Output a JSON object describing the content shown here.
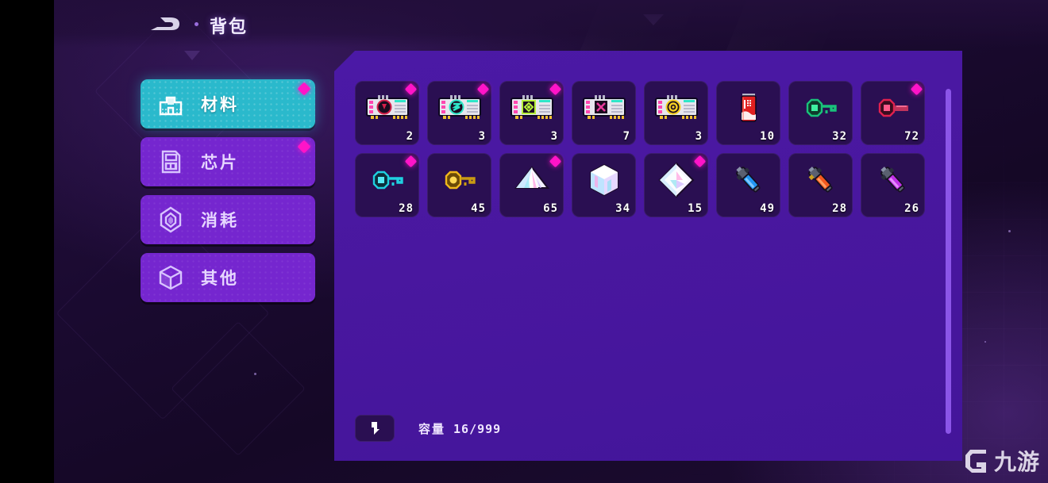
{
  "header": {
    "title": "背包",
    "logo_icon": "game-logo-icon"
  },
  "sidebar": {
    "items": [
      {
        "label": "材料",
        "icon": "materials-icon",
        "active": true,
        "badge": true
      },
      {
        "label": "芯片",
        "icon": "chip-icon",
        "active": false,
        "badge": true
      },
      {
        "label": "消耗",
        "icon": "gem-icon",
        "active": false,
        "badge": false
      },
      {
        "label": "其他",
        "icon": "cube-icon",
        "active": false,
        "badge": false
      }
    ]
  },
  "inventory": {
    "rows": [
      [
        {
          "icon": "gpu-card-red-icon",
          "count": "2",
          "badge": true
        },
        {
          "icon": "gpu-card-cyan-icon",
          "count": "3",
          "badge": true
        },
        {
          "icon": "gpu-card-green-icon",
          "count": "3",
          "badge": true
        },
        {
          "icon": "gpu-card-magenta-icon",
          "count": "7",
          "badge": false
        },
        {
          "icon": "gpu-card-yellow-icon",
          "count": "3",
          "badge": false
        },
        {
          "icon": "soda-can-icon",
          "count": "10",
          "badge": false
        },
        {
          "icon": "key-green-icon",
          "count": "32",
          "badge": false
        },
        {
          "icon": "key-red-icon",
          "count": "72",
          "badge": true
        }
      ],
      [
        {
          "icon": "key-cyan-icon",
          "count": "28",
          "badge": true
        },
        {
          "icon": "key-gold-icon",
          "count": "45",
          "badge": false
        },
        {
          "icon": "crystal-pyramid-icon",
          "count": "65",
          "badge": true
        },
        {
          "icon": "crystal-cube-icon",
          "count": "34",
          "badge": false
        },
        {
          "icon": "crystal-diamond-icon",
          "count": "15",
          "badge": true
        },
        {
          "icon": "injector-blue-icon",
          "count": "49",
          "badge": false
        },
        {
          "icon": "injector-orange-icon",
          "count": "28",
          "badge": false
        },
        {
          "icon": "injector-purple-icon",
          "count": "26",
          "badge": false
        }
      ]
    ]
  },
  "footer": {
    "sort_icon": "sort-arrow-icon",
    "capacity_label": "容量",
    "capacity_value": "16/999"
  },
  "watermark": {
    "text": "九游",
    "icon": "watermark-logo-icon"
  },
  "colors": {
    "accent_teal": "#2ab9cc",
    "panel_purple": "#4b19a6",
    "nav_purple": "#7526cf",
    "badge_magenta": "#ff14c8",
    "slot_bg": "#2a0f52"
  }
}
